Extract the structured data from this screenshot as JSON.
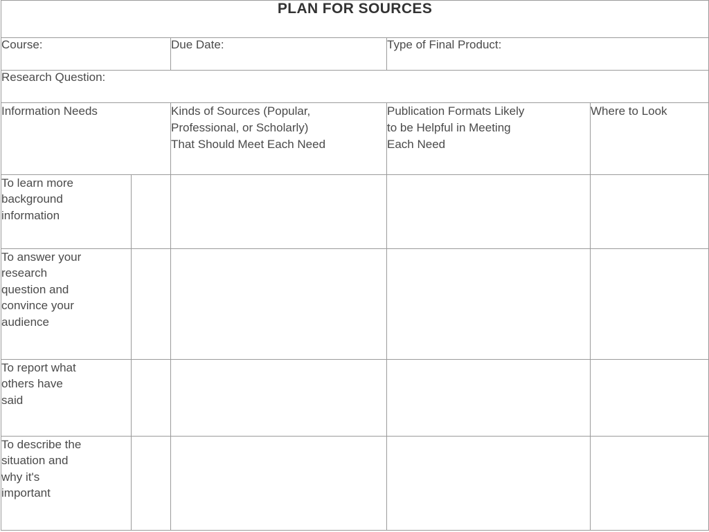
{
  "document": {
    "title": "PLAN FOR SOURCES"
  },
  "meta_row": {
    "course_label": "Course:",
    "due_date_label": "Due Date:",
    "final_product_label": "Type of Final Product:"
  },
  "research_question_row": {
    "label": "Research Question:"
  },
  "table": {
    "headers": [
      "Information Needs",
      "Kinds of Sources (Popular,\nProfessional, or Scholarly)\nThat Should Meet Each Need",
      "Publication Formats Likely\nto be Helpful in Meeting\nEach Need",
      "Where to Look"
    ],
    "rows": [
      {
        "need": "To learn more\nbackground\ninformation",
        "narrow": "",
        "kinds_of_sources": "",
        "publication_formats": "",
        "where_to_look": ""
      },
      {
        "need": "To answer your\nresearch\nquestion and\nconvince your\naudience",
        "narrow": "",
        "kinds_of_sources": "",
        "publication_formats": "",
        "where_to_look": ""
      },
      {
        "need": "To report what\nothers have\nsaid",
        "narrow": "",
        "kinds_of_sources": "",
        "publication_formats": "",
        "where_to_look": ""
      },
      {
        "need": "To describe the\nsituation and\nwhy it's\nimportant",
        "narrow": "",
        "kinds_of_sources": "",
        "publication_formats": "",
        "where_to_look": ""
      }
    ]
  },
  "colors": {
    "border": "#9a9a9a",
    "text": "#4a4a4a",
    "title_text": "#333333",
    "background": "#ffffff"
  }
}
